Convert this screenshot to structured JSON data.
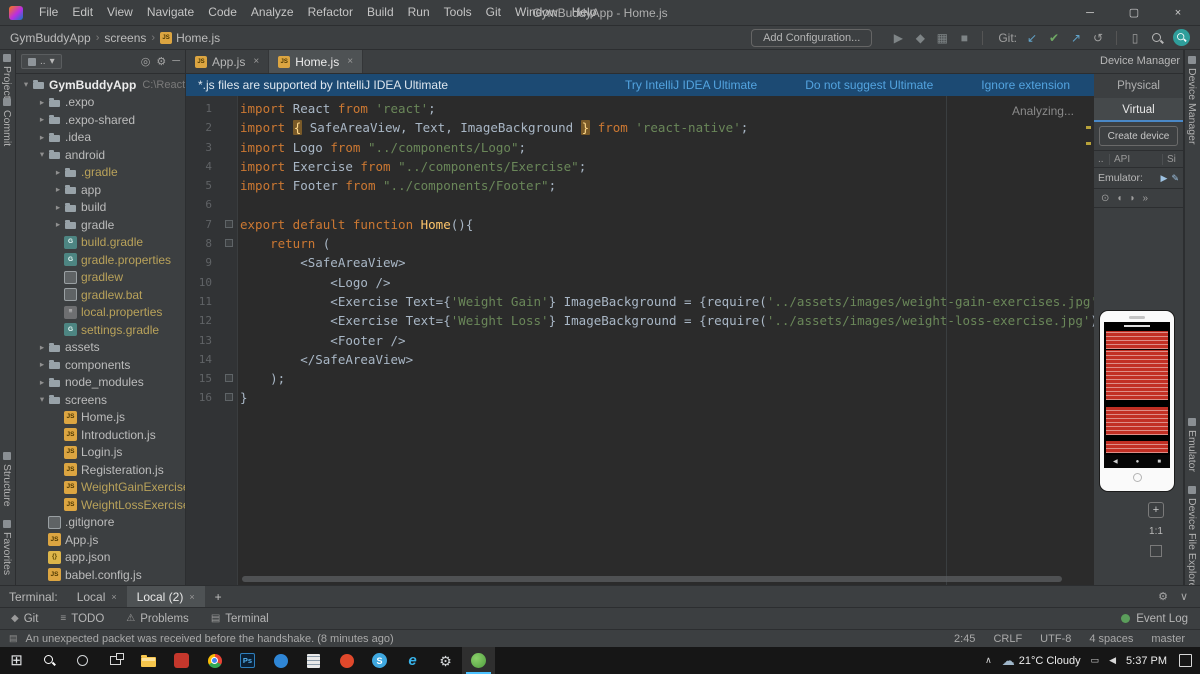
{
  "titlebar": {
    "menus": [
      "File",
      "Edit",
      "View",
      "Navigate",
      "Code",
      "Analyze",
      "Refactor",
      "Build",
      "Run",
      "Tools",
      "Git",
      "Window",
      "Help"
    ],
    "title": "GymBuddyApp - Home.js"
  },
  "toolbar": {
    "breadcrumb": [
      "GymBuddyApp",
      "screens",
      "Home.js"
    ],
    "add_config": "Add Configuration...",
    "items": [
      {
        "name": "run-button",
        "glyph": "▶",
        "color": "#7e8486"
      },
      {
        "name": "debug-button",
        "glyph": "◆",
        "color": "#7e8486"
      },
      {
        "name": "coverage-button",
        "glyph": "▦",
        "color": "#7e8486"
      },
      {
        "name": "stop-button",
        "glyph": "■",
        "color": "#7e8486"
      },
      {
        "sep": true
      },
      {
        "label": "Git:"
      },
      {
        "name": "git-update-button",
        "glyph": "↙",
        "color": "#61a3c9"
      },
      {
        "name": "git-commit-button",
        "glyph": "✔",
        "color": "#6fa864"
      },
      {
        "name": "git-push-button",
        "glyph": "↗",
        "color": "#61a3c9"
      },
      {
        "name": "git-rollback-button",
        "glyph": "↺",
        "color": "#9f9f9f"
      },
      {
        "sep": true
      },
      {
        "name": "layout-button",
        "glyph": "▯",
        "color": "#9f9f9f"
      },
      {
        "kind": "mag",
        "name": "search-icon"
      },
      {
        "kind": "se",
        "name": "search-everywhere-button"
      }
    ]
  },
  "left_strip": [
    "Project",
    "Commit",
    "Structure",
    "Favorites"
  ],
  "right_strip": [
    "Device Manager",
    "Emulator",
    "Device File Explorer"
  ],
  "project_panel": {
    "selector": "..",
    "icons": [
      {
        "name": "locate-icon",
        "glyph": "◎"
      },
      {
        "name": "settings-icon",
        "glyph": "⚙"
      },
      {
        "name": "hide-icon",
        "glyph": "─"
      }
    ]
  },
  "project_tree": {
    "items": [
      {
        "l": "GymBuddyApp",
        "x": "C:\\React-N",
        "lv": 0,
        "ic": "folder",
        "ar": "e",
        "cl": "w"
      },
      {
        "l": ".expo",
        "lv": 1,
        "ic": "folder",
        "ar": "c"
      },
      {
        "l": ".expo-shared",
        "lv": 1,
        "ic": "folder",
        "ar": "c"
      },
      {
        "l": ".idea",
        "lv": 1,
        "ic": "folder",
        "ar": "c"
      },
      {
        "l": "android",
        "lv": 1,
        "ic": "folder",
        "ar": "e"
      },
      {
        "l": ".gradle",
        "lv": 2,
        "ic": "folder",
        "ar": "c",
        "cl": "o"
      },
      {
        "l": "app",
        "lv": 2,
        "ic": "folder",
        "ar": "c"
      },
      {
        "l": "build",
        "lv": 2,
        "ic": "folder",
        "ar": "c"
      },
      {
        "l": "gradle",
        "lv": 2,
        "ic": "folder",
        "ar": "c"
      },
      {
        "l": "build.gradle",
        "lv": 2,
        "ic": "gradle",
        "cl": "o"
      },
      {
        "l": "gradle.properties",
        "lv": 2,
        "ic": "gradle",
        "cl": "o"
      },
      {
        "l": "gradlew",
        "lv": 2,
        "ic": "file",
        "cl": "o"
      },
      {
        "l": "gradlew.bat",
        "lv": 2,
        "ic": "file",
        "cl": "o"
      },
      {
        "l": "local.properties",
        "lv": 2,
        "ic": "props",
        "cl": "o"
      },
      {
        "l": "settings.gradle",
        "lv": 2,
        "ic": "gradle",
        "cl": "o"
      },
      {
        "l": "assets",
        "lv": 1,
        "ic": "folder",
        "ar": "c"
      },
      {
        "l": "components",
        "lv": 1,
        "ic": "folder",
        "ar": "c"
      },
      {
        "l": "node_modules",
        "lv": 1,
        "ic": "folder",
        "ar": "c"
      },
      {
        "l": "screens",
        "lv": 1,
        "ic": "folder",
        "ar": "e"
      },
      {
        "l": "Home.js",
        "lv": 2,
        "ic": "js"
      },
      {
        "l": "Introduction.js",
        "lv": 2,
        "ic": "js"
      },
      {
        "l": "Login.js",
        "lv": 2,
        "ic": "js"
      },
      {
        "l": "Registeration.js",
        "lv": 2,
        "ic": "js"
      },
      {
        "l": "WeightGainExercises",
        "lv": 2,
        "ic": "js",
        "cl": "o"
      },
      {
        "l": "WeightLossExercises",
        "lv": 2,
        "ic": "js",
        "cl": "o"
      },
      {
        "l": ".gitignore",
        "lv": 1,
        "ic": "file"
      },
      {
        "l": "App.js",
        "lv": 1,
        "ic": "js"
      },
      {
        "l": "app.json",
        "lv": 1,
        "ic": "json"
      },
      {
        "l": "babel.config.js",
        "lv": 1,
        "ic": "js"
      }
    ]
  },
  "editor": {
    "tabs": [
      {
        "label": "App.js"
      },
      {
        "label": "Home.js",
        "active": true
      }
    ],
    "banner": {
      "text": "*.js files are supported by IntelliJ IDEA Ultimate",
      "links": [
        "Try IntelliJ IDEA Ultimate",
        "Do not suggest Ultimate",
        "Ignore extension"
      ]
    },
    "status": "Analyzing...",
    "code": [
      {
        "n": 1,
        "seg": [
          [
            "k",
            "import "
          ],
          [
            "p",
            "React "
          ],
          [
            "k",
            "from "
          ],
          [
            "s",
            "'react'"
          ],
          [
            "p",
            ";"
          ]
        ]
      },
      {
        "n": 2,
        "seg": [
          [
            "k",
            "import "
          ],
          [
            "b",
            "{"
          ],
          [
            "p",
            " SafeAreaView, Text, ImageBackground "
          ],
          [
            "b",
            "}"
          ],
          [
            "k",
            " from "
          ],
          [
            "s",
            "'react-native'"
          ],
          [
            "p",
            ";"
          ]
        ]
      },
      {
        "n": 3,
        "seg": [
          [
            "k",
            "import "
          ],
          [
            "p",
            "Logo "
          ],
          [
            "k",
            "from "
          ],
          [
            "s",
            "\"../components/Logo\""
          ],
          [
            "p",
            ";"
          ]
        ]
      },
      {
        "n": 4,
        "seg": [
          [
            "k",
            "import "
          ],
          [
            "p",
            "Exercise "
          ],
          [
            "k",
            "from "
          ],
          [
            "s",
            "\"../components/Exercise\""
          ],
          [
            "p",
            ";"
          ]
        ]
      },
      {
        "n": 5,
        "seg": [
          [
            "k",
            "import "
          ],
          [
            "p",
            "Footer "
          ],
          [
            "k",
            "from "
          ],
          [
            "s",
            "\"../components/Footer\""
          ],
          [
            "p",
            ";"
          ]
        ]
      },
      {
        "n": 6,
        "seg": []
      },
      {
        "n": 7,
        "fold": true,
        "seg": [
          [
            "k",
            "export default function "
          ],
          [
            "f",
            "Home"
          ],
          [
            "p",
            "(){"
          ]
        ]
      },
      {
        "n": 8,
        "fold": true,
        "seg": [
          [
            "p",
            "    "
          ],
          [
            "k",
            "return"
          ],
          [
            "p",
            " ("
          ]
        ]
      },
      {
        "n": 9,
        "seg": [
          [
            "p",
            "        <SafeAreaView>"
          ]
        ]
      },
      {
        "n": 10,
        "seg": [
          [
            "p",
            "            <Logo />"
          ]
        ]
      },
      {
        "n": 11,
        "seg": [
          [
            "p",
            "            <Exercise Text={"
          ],
          [
            "s",
            "'Weight Gain'"
          ],
          [
            "p",
            "} ImageBackground = {require("
          ],
          [
            "s",
            "'../assets/images/weight-gain-exercises.jpg'"
          ],
          [
            "p",
            ")} />"
          ]
        ]
      },
      {
        "n": 12,
        "seg": [
          [
            "p",
            "            <Exercise Text={"
          ],
          [
            "s",
            "'Weight Loss'"
          ],
          [
            "p",
            "} ImageBackground = {require("
          ],
          [
            "s",
            "'../assets/images/weight-loss-exercise.jpg'"
          ],
          [
            "p",
            ")} />"
          ]
        ]
      },
      {
        "n": 13,
        "seg": [
          [
            "p",
            "            <Footer />"
          ]
        ]
      },
      {
        "n": 14,
        "seg": [
          [
            "p",
            "        </SafeAreaView>"
          ]
        ]
      },
      {
        "n": 15,
        "fold": true,
        "seg": [
          [
            "p",
            "    );"
          ]
        ]
      },
      {
        "n": 16,
        "fold": true,
        "seg": [
          [
            "p",
            "}"
          ]
        ]
      }
    ]
  },
  "device_manager": {
    "title": "Device Manager",
    "tabs": [
      {
        "label": "Physical"
      },
      {
        "label": "Virtual",
        "active": true
      }
    ],
    "create_button": "Create device",
    "columns": [
      "..",
      "API",
      "Si"
    ],
    "device_name": "Emulator:",
    "row_icons": [
      {
        "name": "launch-device-icon",
        "glyph": "▶"
      },
      {
        "name": "edit-device-icon",
        "glyph": "✎"
      }
    ],
    "emulator_toolbar": [
      {
        "name": "power-icon",
        "glyph": "⊙"
      },
      {
        "name": "volume-down-icon",
        "glyph": "◖"
      },
      {
        "name": "volume-up-icon",
        "glyph": "◗"
      },
      {
        "name": "overflow-icon",
        "glyph": "»"
      }
    ],
    "zoom_plus": "+",
    "zoom_ratio": "1:1"
  },
  "terminal": {
    "label": "Terminal:",
    "tabs": [
      {
        "label": "Local"
      },
      {
        "label": "Local (2)",
        "active": true
      }
    ]
  },
  "toolwindows": {
    "left": [
      {
        "label": "Git",
        "glyph": "◆"
      },
      {
        "label": "TODO",
        "glyph": "≡"
      },
      {
        "label": "Problems",
        "glyph": "⚠"
      },
      {
        "label": "Terminal",
        "glyph": "▤"
      }
    ],
    "right": {
      "label": "Event Log"
    }
  },
  "statusbar": {
    "message": "An unexpected packet was received before the handshake. (8 minutes ago)",
    "items": [
      {
        "name": "caret-position",
        "text": "2:45"
      },
      {
        "name": "line-separator",
        "text": "CRLF"
      },
      {
        "name": "file-encoding",
        "text": "UTF-8"
      },
      {
        "name": "indent-style",
        "text": "4 spaces"
      },
      {
        "name": "git-branch",
        "text": "master"
      }
    ]
  },
  "taskbar": {
    "icons": [
      {
        "name": "start-button",
        "kind": "win"
      },
      {
        "name": "search-button",
        "kind": "mag"
      },
      {
        "name": "cortana-button",
        "kind": "ring"
      },
      {
        "name": "task-view-button",
        "kind": "tview"
      },
      {
        "name": "file-explorer-icon",
        "kind": "folder"
      },
      {
        "name": "utorrent-icon",
        "kind": "red"
      },
      {
        "name": "chrome-icon",
        "kind": "chrome"
      },
      {
        "name": "photoshop-icon",
        "kind": "ps",
        "label": "Ps"
      },
      {
        "name": "app-blue-icon",
        "kind": "blue"
      },
      {
        "name": "notes-icon",
        "kind": "doc"
      },
      {
        "name": "opera-icon",
        "kind": "orange"
      },
      {
        "name": "skype-icon",
        "kind": "skype",
        "label": "S"
      },
      {
        "name": "edge-icon",
        "kind": "edge",
        "label": "e"
      },
      {
        "name": "settings-icon",
        "kind": "gear"
      },
      {
        "name": "android-studio-icon",
        "kind": "android",
        "active": true
      }
    ],
    "weather": "21°C Cloudy",
    "time": "5:37 PM"
  }
}
